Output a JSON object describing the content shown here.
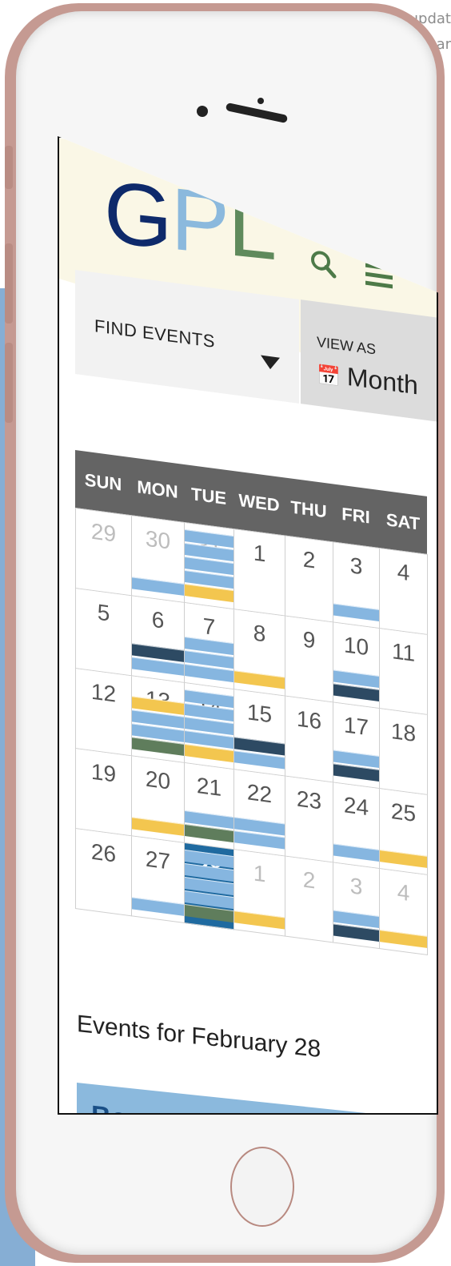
{
  "corner_text": [
    "updat",
    "mar"
  ],
  "logo": {
    "g": "G",
    "p": "P",
    "l": "L"
  },
  "header": {
    "search_icon": "search-icon",
    "menu_icon": "hamburger-menu-icon"
  },
  "filters": {
    "find_events_label": "FIND EVENTS",
    "view_as_label": "VIEW AS",
    "view_as_value": "Month",
    "view_as_icon": "calendar-icon"
  },
  "calendar": {
    "days": [
      "SUN",
      "MON",
      "TUE",
      "WED",
      "THU",
      "FRI",
      "SAT"
    ],
    "weeks": [
      [
        {
          "n": "29",
          "m": true,
          "b": []
        },
        {
          "n": "30",
          "m": true,
          "b": [
            "#86b6e0"
          ]
        },
        {
          "n": "31",
          "m": true,
          "b": [
            "#86b6e0",
            "#86b6e0",
            "#86b6e0",
            "#86b6e0",
            "#f3c64f"
          ]
        },
        {
          "n": "1",
          "b": []
        },
        {
          "n": "2",
          "b": []
        },
        {
          "n": "3",
          "b": [
            "#86b6e0"
          ]
        },
        {
          "n": "4",
          "b": []
        }
      ],
      [
        {
          "n": "5",
          "b": []
        },
        {
          "n": "6",
          "b": [
            "#2d4a63",
            "#86b6e0"
          ]
        },
        {
          "n": "7",
          "b": [
            "#86b6e0",
            "#86b6e0",
            "#86b6e0"
          ]
        },
        {
          "n": "8",
          "b": [
            "#f3c64f"
          ]
        },
        {
          "n": "9",
          "b": []
        },
        {
          "n": "10",
          "b": [
            "#86b6e0",
            "#2d4a63"
          ]
        },
        {
          "n": "11",
          "b": []
        }
      ],
      [
        {
          "n": "12",
          "b": []
        },
        {
          "n": "13",
          "b": [
            "#f3c64f",
            "#86b6e0",
            "#86b6e0",
            "#5f7d5c"
          ]
        },
        {
          "n": "14",
          "b": [
            "#86b6e0",
            "#86b6e0",
            "#86b6e0",
            "#86b6e0",
            "#f3c64f"
          ]
        },
        {
          "n": "15",
          "b": [
            "#2d4a63",
            "#86b6e0"
          ]
        },
        {
          "n": "16",
          "b": []
        },
        {
          "n": "17",
          "b": [
            "#86b6e0",
            "#2d4a63"
          ]
        },
        {
          "n": "18",
          "b": []
        }
      ],
      [
        {
          "n": "19",
          "b": []
        },
        {
          "n": "20",
          "b": [
            "#f3c64f"
          ]
        },
        {
          "n": "21",
          "b": [
            "#86b6e0",
            "#5f7d5c"
          ]
        },
        {
          "n": "22",
          "b": [
            "#86b6e0",
            "#86b6e0"
          ]
        },
        {
          "n": "23",
          "b": []
        },
        {
          "n": "24",
          "b": [
            "#86b6e0"
          ]
        },
        {
          "n": "25",
          "b": [
            "#f3c64f"
          ]
        }
      ],
      [
        {
          "n": "26",
          "b": []
        },
        {
          "n": "27",
          "b": [
            "#86b6e0"
          ]
        },
        {
          "n": "28",
          "today": true,
          "b": [
            "#86b6e0",
            "#86b6e0",
            "#86b6e0",
            "#86b6e0",
            "#5f7d5c"
          ]
        },
        {
          "n": "1",
          "m": true,
          "b": [
            "#f3c64f"
          ]
        },
        {
          "n": "2",
          "m": true,
          "b": []
        },
        {
          "n": "3",
          "m": true,
          "b": [
            "#86b6e0",
            "#2d4a63"
          ]
        },
        {
          "n": "4",
          "m": true,
          "b": [
            "#f3c64f"
          ]
        }
      ]
    ]
  },
  "events": {
    "heading": "Events for February 28",
    "first_event_title": "Bouncing Books and Babies"
  }
}
